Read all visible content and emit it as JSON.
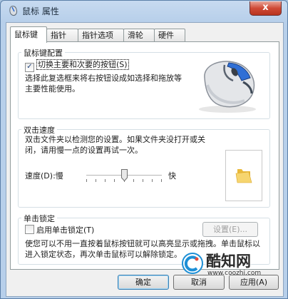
{
  "window": {
    "title": "鼠标 属性",
    "close_glyph": "x"
  },
  "tabs": [
    {
      "label": "鼠标键"
    },
    {
      "label": "指针"
    },
    {
      "label": "指针选项"
    },
    {
      "label": "滑轮"
    },
    {
      "label": "硬件"
    }
  ],
  "button_config": {
    "title": "鼠标键配置",
    "swap_label": "切换主要和次要的按钮",
    "swap_hotkey": "(S)",
    "swap_checked": true,
    "description": "选择此复选框来将右按钮设成如选择和拖放等主要性能使用。"
  },
  "double_click": {
    "title": "双击速度",
    "description": "双击文件夹以检测您的设置。如果文件夹没打开或关闭，请用慢一点的设置再试一次。",
    "speed_label": "速度",
    "speed_hotkey": "(D)",
    "slow_label": "慢",
    "fast_label": "快",
    "speed_value": 0.5
  },
  "click_lock": {
    "title": "单击锁定",
    "enable_label": "启用单击锁定",
    "enable_hotkey": "(T)",
    "enabled": false,
    "settings_button": "设置(E)...",
    "description": "使您可以不用一直按着鼠标按钮就可以高亮显示或拖拽。单击鼠标以进入锁定状态，再次单击鼠标可以解除锁定。"
  },
  "footer": {
    "ok_button": "确定",
    "cancel_button": "取消",
    "apply_button": "应用(A)"
  },
  "watermark": {
    "brand": "酷知网",
    "url": "www.coozhi.com"
  },
  "colors": {
    "accent_blue": "#2f6fd6",
    "folder": "#f0c74a",
    "close_red": "#c8452f"
  }
}
